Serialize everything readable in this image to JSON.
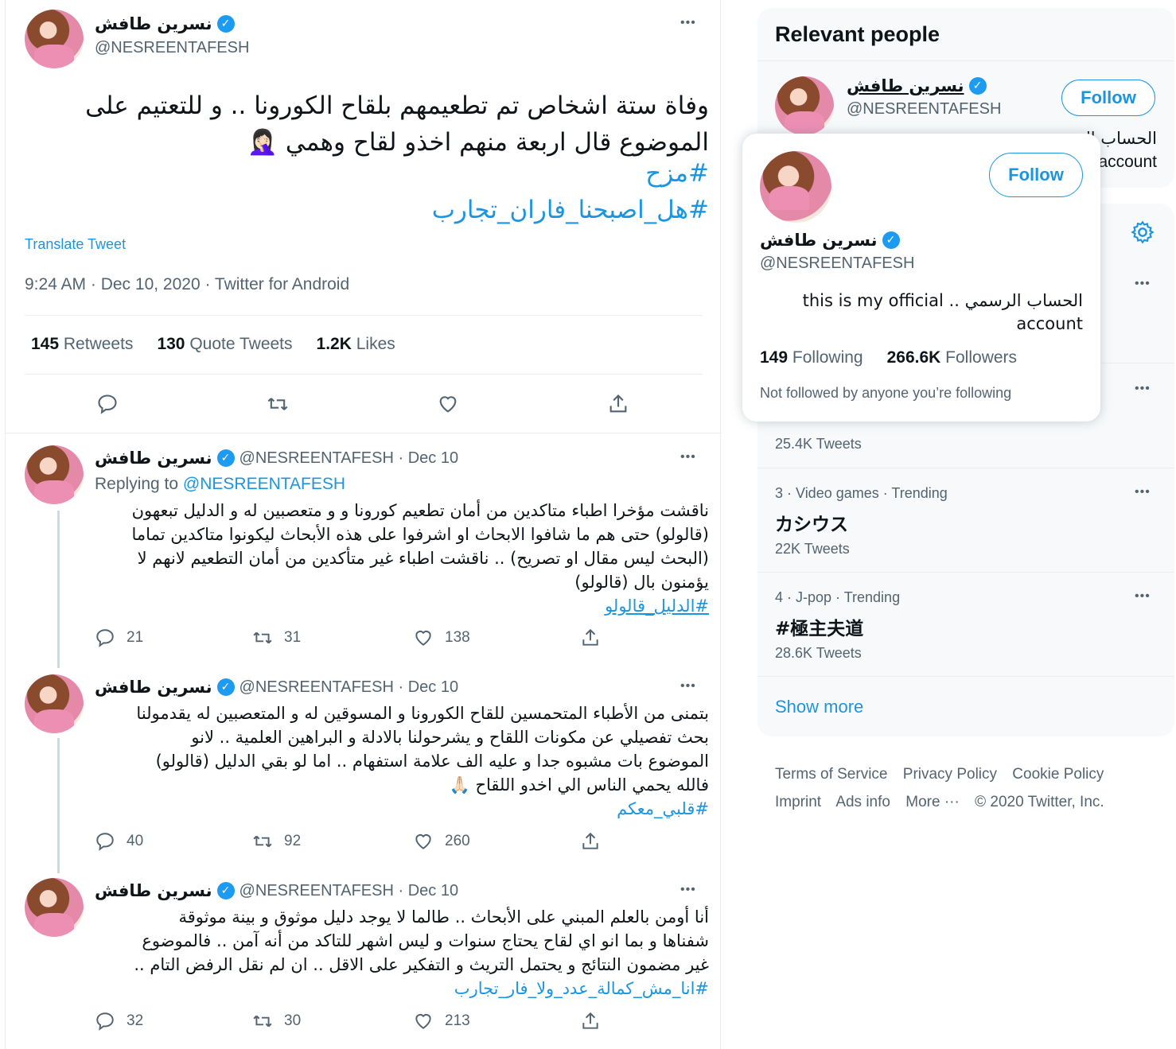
{
  "main_tweet": {
    "display_name": "نسرين طافش",
    "handle": "@NESREENTAFESH",
    "text_line1": "وفاة ستة اشخاص تم تطعيمهم بلقاح الكورونا .. و للتعتيم على",
    "text_line2": "الموضوع قال اربعة منهم اخذو لقاح وهمي 🤦🏻‍♀️",
    "hashtag1": "#مزح",
    "hashtag2": "#هل_اصبحنا_فاران_تجارب",
    "translate_label": "Translate Tweet",
    "meta": "9:24 AM · Dec 10, 2020 · Twitter for Android",
    "retweets_count": "145",
    "retweets_label": "Retweets",
    "quotes_count": "130",
    "quotes_label": "Quote Tweets",
    "likes_count": "1.2K",
    "likes_label": "Likes"
  },
  "replies": [
    {
      "display_name": "نسرين طافش",
      "handle_date": "@NESREENTAFESH · Dec 10",
      "replying_prefix": "Replying to",
      "replying_handle": "@NESREENTAFESH",
      "lines": [
        "ناقشت مؤخرا اطباء متاكدين من أمان تطعيم كورونا و و متعصبين له و الدليل تبعهون",
        "(قالولو) حتى هم ما شافوا الابحاث او اشرفوا على هذه الأبحاث ليكونوا متاكدين تماما",
        "(البحث ليس مقال او تصريح) .. ناقشت اطباء غير متأكدين من أمان التطعيم لانهم لا",
        "يؤمنون بال (قالولو)"
      ],
      "hashtag": "#الدليل_قالولو",
      "reply_count": "21",
      "retweet_count": "31",
      "like_count": "138"
    },
    {
      "display_name": "نسرين طافش",
      "handle_date": "@NESREENTAFESH · Dec 10",
      "lines": [
        "بتمنى من الأطباء المتحمسين للقاح الكورونا و المسوقين له و المتعصبين له يقدمولنا",
        "بحث تفصيلي عن مكونات اللقاح و يشرحولنا بالادلة و البراهين العلمية .. لانو",
        "الموضوع بات مشبوه جدا و عليه الف علامة استفهام .. اما لو بقي الدليل (قالولو)",
        "فالله يحمي الناس الي اخدو اللقاح 🙏🏻"
      ],
      "hashtag": "#قلبي_معكم",
      "reply_count": "40",
      "retweet_count": "92",
      "like_count": "260"
    },
    {
      "display_name": "نسرين طافش",
      "handle_date": "@NESREENTAFESH · Dec 10",
      "lines": [
        "أنا أومن بالعلم المبني على الأبحاث .. طالما لا يوجد دليل موثوق و بينة موثوقة",
        "شفناها و بما انو اي لقاح يحتاج سنوات و ليس اشهر للتاكد من أنه آمن .. فالموضوع",
        "غير مضمون النتائج و يحتمل التريث و التفكير على الاقل .. ان لم نقل الرفض التام .."
      ],
      "hashtag": "#انا_مش_كمالة_عدد_ولا_فار_تجارب",
      "reply_count": "32",
      "retweet_count": "30",
      "like_count": "213"
    }
  ],
  "relevant_people": {
    "title": "Relevant people",
    "display_name": "نسرين طافش",
    "handle": "@NESREENTAFESH",
    "follow_label": "Follow",
    "bio_fragment_1": "الحساب ال",
    "bio_fragment_2": "account"
  },
  "hovercard": {
    "display_name": "نسرين طافش",
    "handle": "@NESREENTAFESH",
    "follow_label": "Follow",
    "bio_line1": "this is my official  .. الحساب الرسمي",
    "bio_line2": "account",
    "following_count": "149",
    "following_label": "Following",
    "followers_count": "266.6K",
    "followers_label": "Followers",
    "note": "Not followed by anyone you’re following"
  },
  "trends": {
    "items": [
      {
        "count": "25.4K Tweets"
      },
      {
        "meta": "3 · Video games · Trending",
        "name": "カシウス",
        "count": "22K Tweets"
      },
      {
        "meta": "4 · J-pop · Trending",
        "name": "#極主夫道",
        "count": "28.6K Tweets"
      }
    ],
    "show_more": "Show more"
  },
  "footer": {
    "terms": "Terms of Service",
    "privacy": "Privacy Policy",
    "cookie": "Cookie Policy",
    "imprint": "Imprint",
    "ads": "Ads info",
    "more": "More ···",
    "copyright": "© 2020 Twitter, Inc."
  },
  "colors": {
    "accent": "#1b95e0",
    "verified": "#1d9bf0",
    "secondary_text": "#536471",
    "panel_bg": "#f7f9fa"
  }
}
